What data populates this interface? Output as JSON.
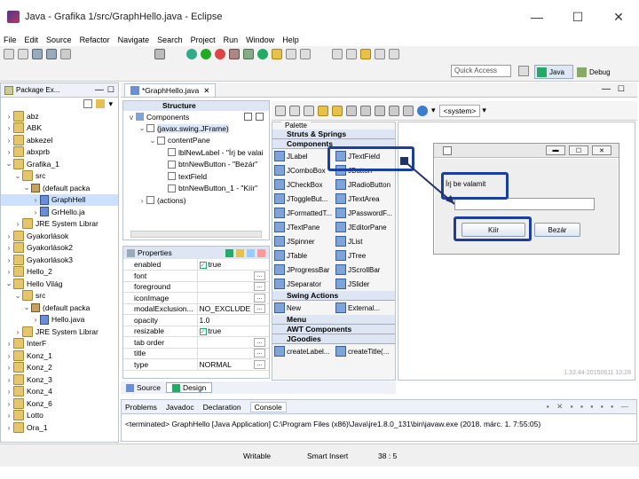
{
  "window": {
    "title": "Java - Grafika 1/src/GraphHello.java - Eclipse",
    "minimize": "—",
    "maximize": "☐",
    "close": "✕"
  },
  "menu": [
    "File",
    "Edit",
    "Source",
    "Refactor",
    "Navigate",
    "Search",
    "Project",
    "Run",
    "Window",
    "Help"
  ],
  "toolbar": {
    "quick_access": "Quick Access",
    "perspective_java": "Java",
    "perspective_debug": "Debug"
  },
  "package_explorer": {
    "tab": "Package Ex...",
    "items": [
      {
        "label": "abz",
        "type": "project",
        "indent": 0,
        "chev": ">"
      },
      {
        "label": "ABK",
        "type": "project",
        "indent": 0,
        "chev": ">"
      },
      {
        "label": "abkezel",
        "type": "project",
        "indent": 0,
        "chev": ">"
      },
      {
        "label": "abxprb",
        "type": "project",
        "indent": 0,
        "chev": ">"
      },
      {
        "label": "Grafika_1",
        "type": "project",
        "indent": 0,
        "chev": "v"
      },
      {
        "label": "src",
        "type": "folder",
        "indent": 1,
        "chev": "v"
      },
      {
        "label": "(default packa",
        "type": "pkg",
        "indent": 2,
        "chev": "v"
      },
      {
        "label": "GraphHell",
        "type": "java",
        "indent": 3,
        "chev": ">",
        "selected": true
      },
      {
        "label": "GrHello.ja",
        "type": "java",
        "indent": 3,
        "chev": ">"
      },
      {
        "label": "JRE System Librar",
        "type": "lib",
        "indent": 1,
        "chev": ">"
      },
      {
        "label": "Gyakorlások",
        "type": "project",
        "indent": 0,
        "chev": ">"
      },
      {
        "label": "Gyakorlások2",
        "type": "project",
        "indent": 0,
        "chev": ">"
      },
      {
        "label": "Gyakorlások3",
        "type": "project",
        "indent": 0,
        "chev": ">"
      },
      {
        "label": "Hello_2",
        "type": "project",
        "indent": 0,
        "chev": ">"
      },
      {
        "label": "Hello Világ",
        "type": "project",
        "indent": 0,
        "chev": "v"
      },
      {
        "label": "src",
        "type": "folder",
        "indent": 1,
        "chev": "v"
      },
      {
        "label": "(default packa",
        "type": "pkg",
        "indent": 2,
        "chev": "v"
      },
      {
        "label": "Hello.java",
        "type": "java",
        "indent": 3,
        "chev": ">"
      },
      {
        "label": "JRE System Librar",
        "type": "lib",
        "indent": 1,
        "chev": ">"
      },
      {
        "label": "InterF",
        "type": "project",
        "indent": 0,
        "chev": ">"
      },
      {
        "label": "Konz_1",
        "type": "project",
        "indent": 0,
        "chev": ">"
      },
      {
        "label": "Konz_2",
        "type": "project",
        "indent": 0,
        "chev": ">"
      },
      {
        "label": "Konz_3",
        "type": "project",
        "indent": 0,
        "chev": ">"
      },
      {
        "label": "Konz_4",
        "type": "project",
        "indent": 0,
        "chev": ">"
      },
      {
        "label": "Konz_6",
        "type": "project",
        "indent": 0,
        "chev": ">"
      },
      {
        "label": "Lotto",
        "type": "project",
        "indent": 0,
        "chev": ">"
      },
      {
        "label": "Ora_1",
        "type": "project",
        "indent": 0,
        "chev": ">"
      }
    ]
  },
  "editor_tab": "*GraphHello.java",
  "structure": {
    "header": "Structure",
    "components_label": "Components",
    "tree": [
      {
        "label": "(javax.swing.JFrame)",
        "indent": 0,
        "chev": "v"
      },
      {
        "label": "contentPane",
        "indent": 1,
        "chev": "v"
      },
      {
        "label": "lblNewLabel - \"Írj be valai",
        "indent": 2,
        "chev": ""
      },
      {
        "label": "btnNewButton - \"Bezár\"",
        "indent": 2,
        "chev": ""
      },
      {
        "label": "textField",
        "indent": 2,
        "chev": ""
      },
      {
        "label": "btnNewButton_1 - \"Kiír\"",
        "indent": 2,
        "chev": ""
      },
      {
        "label": "(actions)",
        "indent": 0,
        "chev": ">"
      }
    ]
  },
  "properties": {
    "header": "Properties",
    "rows": [
      {
        "name": "enabled",
        "value": "true",
        "check": true
      },
      {
        "name": "font",
        "value": ""
      },
      {
        "name": "foreground",
        "value": ""
      },
      {
        "name": "iconImage",
        "value": ""
      },
      {
        "name": "modalExclusion...",
        "value": "NO_EXCLUDE"
      },
      {
        "name": "opacity",
        "value": "1.0"
      },
      {
        "name": "resizable",
        "value": "true",
        "check": true
      },
      {
        "name": "tab order",
        "value": ""
      },
      {
        "name": "title",
        "value": ""
      },
      {
        "name": "type",
        "value": "NORMAL"
      }
    ]
  },
  "palette": {
    "header": "Palette",
    "groups": [
      {
        "title": "Struts & Springs",
        "items": []
      },
      {
        "title": "Components",
        "items": [
          "JLabel",
          "JTextField",
          "JComboBox",
          "JButton",
          "JCheckBox",
          "JRadioButton",
          "JToggleBut...",
          "JTextArea",
          "JFormattedT...",
          "JPasswordF...",
          "JTextPane",
          "JEditorPane",
          "JSpinner",
          "JList",
          "JTable",
          "JTree",
          "JProgressBar",
          "JScrollBar",
          "JSeparator",
          "JSlider"
        ]
      },
      {
        "title": "Swing Actions",
        "items": [
          "New",
          "External..."
        ]
      },
      {
        "title": "Menu",
        "items": []
      },
      {
        "title": "AWT Components",
        "items": []
      },
      {
        "title": "JGoodies",
        "items": [
          "createLabel...",
          "createTitle(..."
        ]
      }
    ]
  },
  "designer": {
    "system_label": "<system>",
    "frame": {
      "label": "Írj be valamit",
      "button1": "Kiír",
      "button2": "Bezár"
    },
    "watermark": "1.33.44-20150611 10:28"
  },
  "bottom_tabs": {
    "source": "Source",
    "design": "Design"
  },
  "console": {
    "tabs": [
      "Problems",
      "Javadoc",
      "Declaration",
      "Console"
    ],
    "text": "<terminated> GraphHello [Java Application] C:\\Program Files (x86)\\Java\\jre1.8.0_131\\bin\\javaw.exe (2018. márc. 1. 7:55:05)"
  },
  "status": {
    "mode": "Writable",
    "insert": "Smart Insert",
    "position": "38 : 5"
  },
  "colors": {
    "highlight": "#1a3fa0",
    "selection": "#cce0ff"
  }
}
